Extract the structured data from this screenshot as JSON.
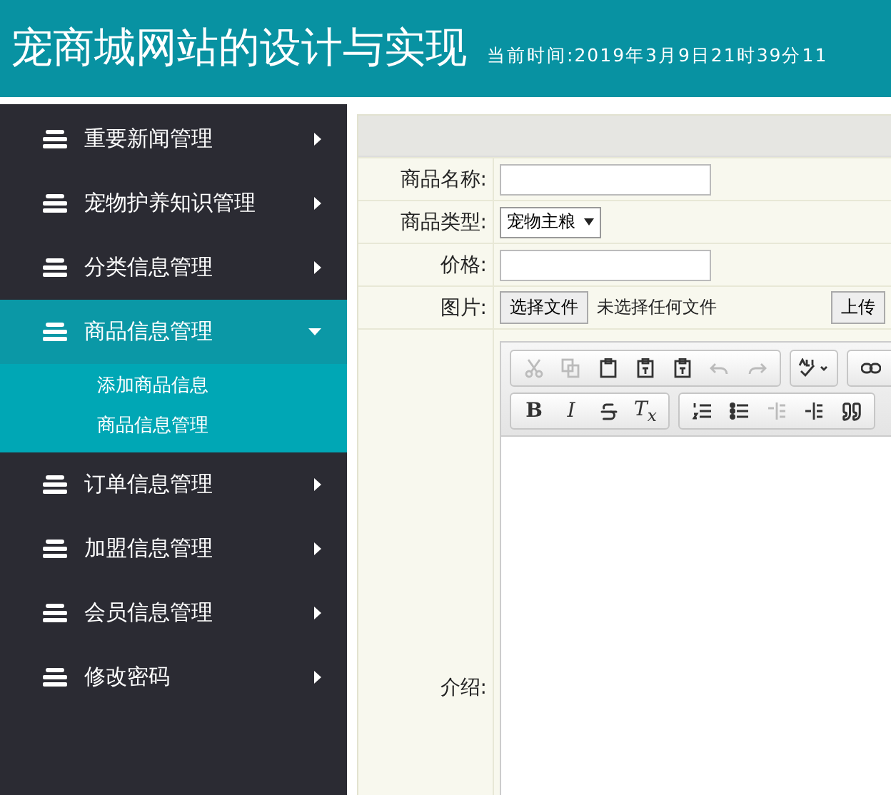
{
  "header": {
    "title": "宠商城网站的设计与实现",
    "time": "当前时间:2019年3月9日21时39分11"
  },
  "sidebar": {
    "items": [
      {
        "label": "重要新闻管理",
        "expanded": false
      },
      {
        "label": "宠物护养知识管理",
        "expanded": false
      },
      {
        "label": "分类信息管理",
        "expanded": false
      },
      {
        "label": "商品信息管理",
        "expanded": true,
        "children": [
          {
            "label": "添加商品信息"
          },
          {
            "label": "商品信息管理"
          }
        ]
      },
      {
        "label": "订单信息管理",
        "expanded": false
      },
      {
        "label": "加盟信息管理",
        "expanded": false
      },
      {
        "label": "会员信息管理",
        "expanded": false
      },
      {
        "label": "修改密码",
        "expanded": false
      }
    ]
  },
  "form": {
    "fields": [
      {
        "kind": "text",
        "label": "商品名称:"
      },
      {
        "kind": "select",
        "label": "商品类型:",
        "value": "宠物主粮"
      },
      {
        "kind": "text",
        "label": "价格:"
      },
      {
        "kind": "file",
        "label": "图片:",
        "button": "选择文件",
        "status": "未选择任何文件",
        "action": "上传"
      },
      {
        "kind": "editor",
        "label": "介绍:"
      }
    ]
  },
  "editor": {
    "toolbar_rows": [
      [
        [
          {
            "kind": "cut",
            "disabled": true
          },
          {
            "kind": "copy",
            "disabled": true
          },
          {
            "kind": "paste",
            "disabled": false
          },
          {
            "kind": "paste-text",
            "disabled": false
          },
          {
            "kind": "paste-word",
            "disabled": false
          },
          {
            "kind": "undo",
            "disabled": true
          },
          {
            "kind": "redo",
            "disabled": true
          }
        ],
        [
          {
            "kind": "spellcheck",
            "disabled": false
          }
        ],
        [
          {
            "kind": "link",
            "disabled": false
          }
        ]
      ],
      [
        [
          {
            "kind": "bold",
            "label": "B",
            "disabled": false
          },
          {
            "kind": "italic",
            "label": "I",
            "disabled": false
          },
          {
            "kind": "strike",
            "disabled": false
          },
          {
            "kind": "clear",
            "label": "T$_{x}$",
            "disabled": false
          }
        ],
        [
          {
            "kind": "ol",
            "disabled": false
          },
          {
            "kind": "ul",
            "disabled": false
          },
          {
            "kind": "outdent",
            "disabled": true
          },
          {
            "kind": "indent",
            "disabled": false
          },
          {
            "kind": "quote",
            "disabled": false
          }
        ]
      ]
    ]
  }
}
